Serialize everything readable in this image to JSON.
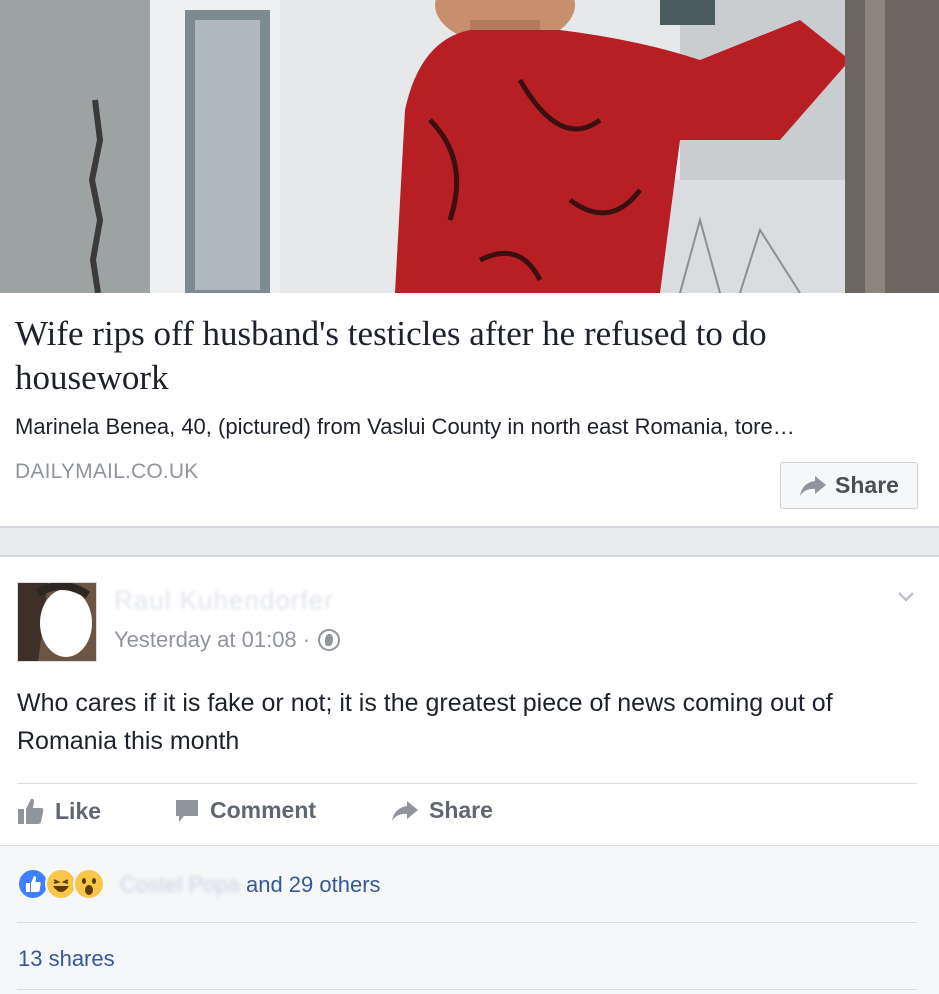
{
  "link_card": {
    "headline": "Wife rips off husband's testicles after he refused to do housework",
    "snippet": "Marinela Benea, 40, (pictured) from Vaslui County in north east Romania, tore…",
    "source": "DAILYMAIL.CO.UK",
    "share_label": "Share",
    "share_icon": "share-arrow-icon"
  },
  "post": {
    "author": "Raul Kuhendorfer",
    "timestamp": "Yesterday at 01:08 ·",
    "privacy_icon": "globe-icon",
    "menu_icon": "chevron-down-icon",
    "text": "Who cares if it is fake or not; it is the greatest piece of news coming out of Romania this month",
    "actions": {
      "like": "Like",
      "comment": "Comment",
      "share": "Share"
    }
  },
  "reactions": {
    "icons": [
      "like-reaction-icon",
      "haha-reaction-icon",
      "wow-reaction-icon"
    ],
    "first_reactor": "Costel Popa",
    "others_text": " and 29 others",
    "shares": "13 shares"
  },
  "colors": {
    "link": "#365899",
    "muted": "#90949c",
    "text": "#1d2129",
    "like_blue": "#4080ff",
    "emoji_yellow": "#f7c64a"
  }
}
